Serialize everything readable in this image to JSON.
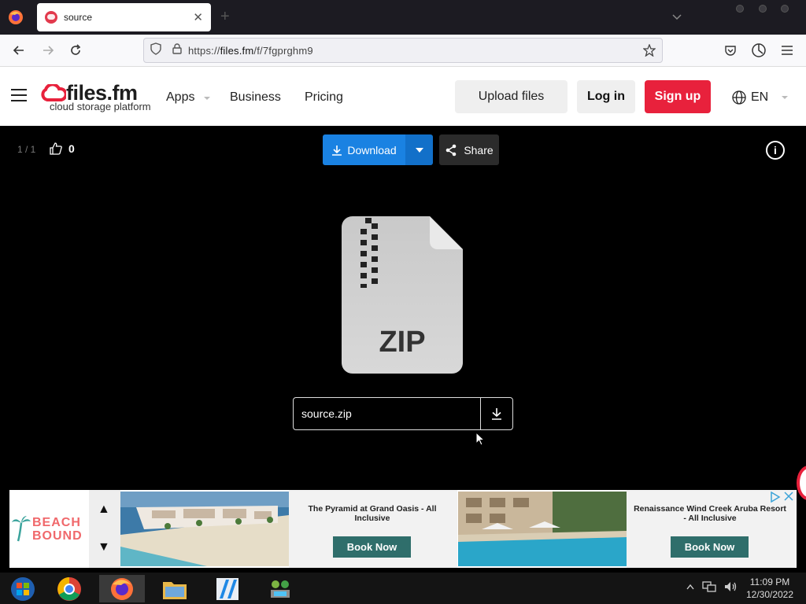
{
  "browser": {
    "tab_title": "source",
    "tab_close": "✕",
    "new_tab": "+",
    "url_prefix": "https://",
    "url_host": "files.fm",
    "url_path": "/f/7fgprghm9"
  },
  "header": {
    "logo_name": "files.fm",
    "logo_tagline": "cloud storage platform",
    "menu_apps": "Apps",
    "menu_business": "Business",
    "menu_pricing": "Pricing",
    "upload_label": "Upload files",
    "login_label": "Log in",
    "signup_label": "Sign up",
    "language": "EN"
  },
  "viewer": {
    "pager": "1 / 1",
    "likes": "0",
    "download_label": "Download",
    "share_label": "Share",
    "file_type": "ZIP",
    "file_name": "source.zip"
  },
  "ad": {
    "brand_line1": "BEACH",
    "brand_line2": "BOUND",
    "up_arrow": "▲",
    "down_arrow": "▼",
    "card1_title": "The Pyramid at Grand Oasis - All Inclusive",
    "card1_button": "Book Now",
    "card2_title": "Renaissance Wind Creek Aruba Resort - All Inclusive",
    "card2_button": "Book Now"
  },
  "taskbar": {
    "time": "11:09 PM",
    "date": "12/30/2022"
  },
  "colors": {
    "brand_red": "#e8213c",
    "download_blue": "#1a82e2",
    "ad_button": "#2f6e6b"
  }
}
